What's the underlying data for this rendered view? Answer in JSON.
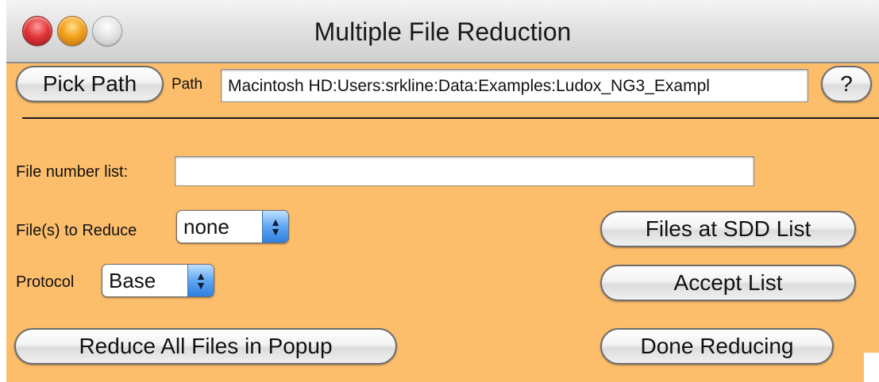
{
  "window": {
    "title": "Multiple File Reduction"
  },
  "path_row": {
    "pick_path_label": "Pick Path",
    "path_label": "Path",
    "path_value": "Macintosh HD:Users:srkline:Data:Examples:Ludox_NG3_Exampl",
    "help_label": "?"
  },
  "file_number": {
    "label": "File number list:",
    "value": ""
  },
  "files_to_reduce": {
    "label": "File(s) to Reduce",
    "selected": "none"
  },
  "protocol": {
    "label": "Protocol",
    "selected": "Base"
  },
  "buttons": {
    "files_at_sdd": "Files at SDD List",
    "accept_list": "Accept List",
    "reduce_all": "Reduce All Files in Popup",
    "done_reducing": "Done Reducing"
  },
  "colors": {
    "panel_background": "#fdbe6c",
    "popup_arrow_blue": "#5fa6f2"
  }
}
